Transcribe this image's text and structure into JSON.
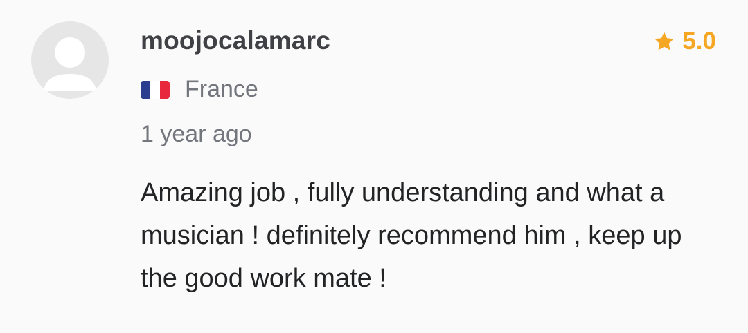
{
  "review": {
    "username": "moojocalamarc",
    "rating": "5.0",
    "rating_icon": "star-icon",
    "rating_color": "#f5a623",
    "country": "France",
    "country_flag": "france-flag-icon",
    "time_ago": "1 year ago",
    "text": "Amazing job , fully understanding and what a musician ! definitely recommend him , keep up the good work mate !"
  }
}
